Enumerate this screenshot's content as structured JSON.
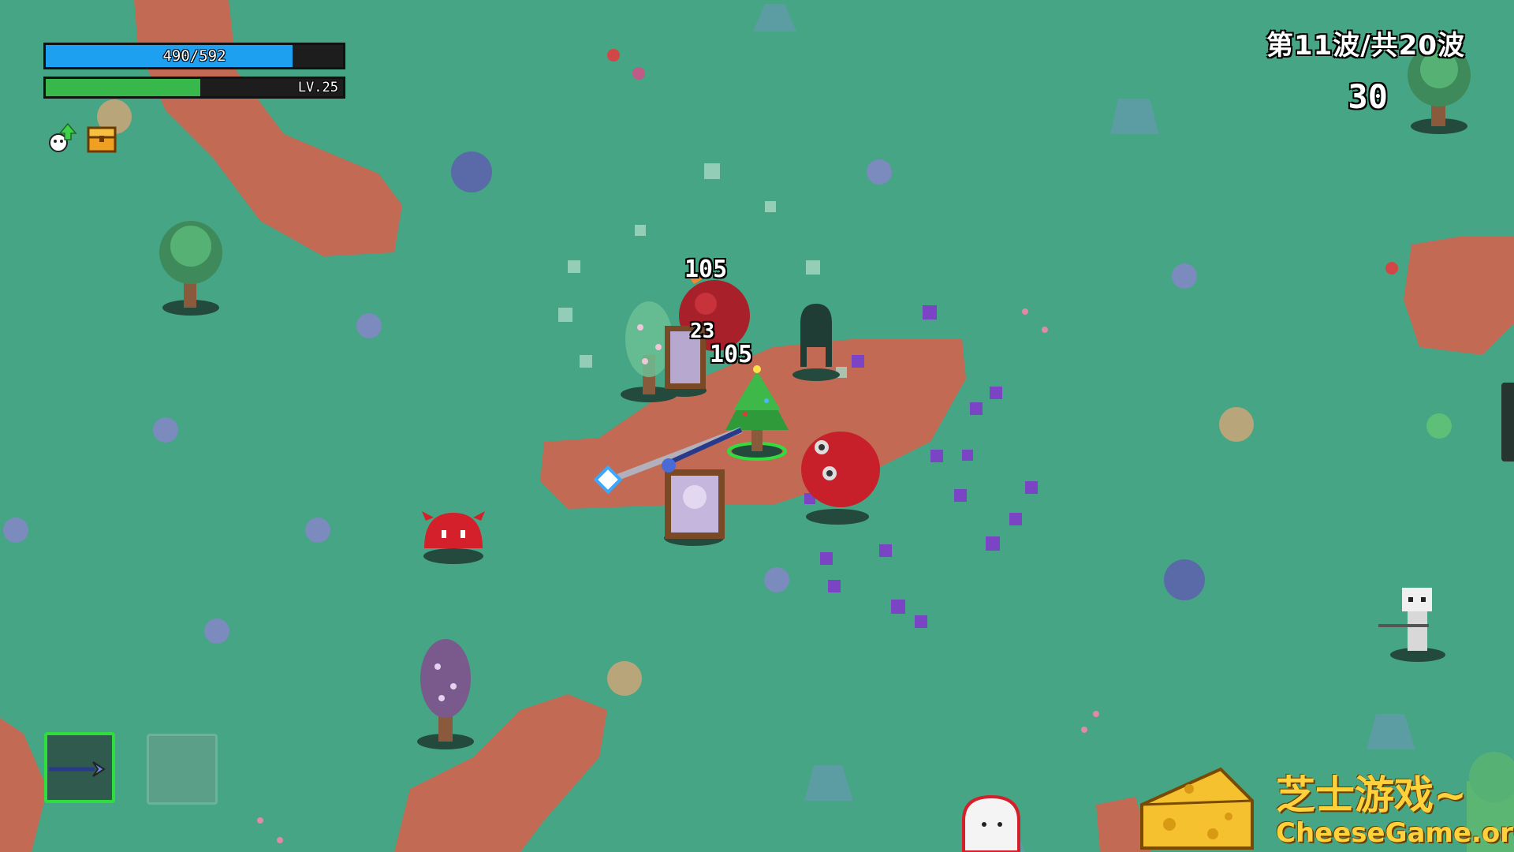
{
  "hud": {
    "health": {
      "current": 490,
      "max": 592,
      "text": "490/592",
      "fraction": 0.83,
      "color": "#1ea0f0"
    },
    "experience": {
      "fraction": 0.52,
      "color": "#38b84a",
      "level_text": "LV.25"
    },
    "status_icons": [
      "upgrade-arrow-icon",
      "treasure-chest-icon"
    ],
    "wave_text": "第11波/共20波",
    "timer": "30"
  },
  "damage_numbers": [
    "105",
    "23",
    "105"
  ],
  "weapon_slots": [
    {
      "icon": "staff-weapon-icon",
      "selected": true
    },
    {
      "icon": "",
      "selected": false
    }
  ],
  "watermark": {
    "title": "芝士游戏~",
    "url": "CheeseGame.org"
  },
  "colors": {
    "ground": "#45a584",
    "dirt": "#c26a54",
    "selection": "#2fde3d"
  }
}
